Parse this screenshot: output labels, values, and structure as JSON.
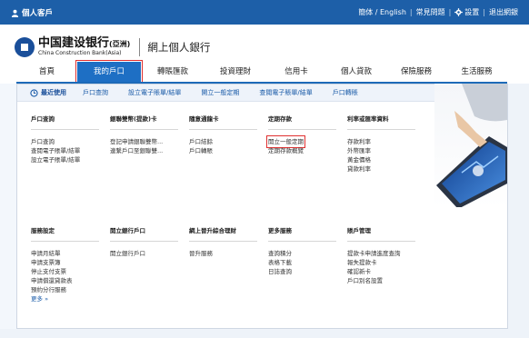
{
  "topbar": {
    "user_label": "個人客戶",
    "links": [
      "簡体 / English",
      "常見問題",
      "設置",
      "退出網銀"
    ]
  },
  "brand": {
    "name_cn": "中国建设银行",
    "name_suffix": "(亞洲)",
    "name_en": "China Construction Bank(Asia)",
    "portal": "網上個人銀行"
  },
  "nav": {
    "items": [
      "首頁",
      "我的戶口",
      "轉賬匯款",
      "投資理財",
      "信用卡",
      "個人貸款",
      "保險服務",
      "生活服務"
    ]
  },
  "subnav": {
    "recent_label": "最近使用",
    "items": [
      "戶口查詢",
      "設立電子賬單/結單",
      "開立一般定期",
      "查閱電子賬單/結單",
      "戶口轉賬"
    ]
  },
  "sections": {
    "account_query": {
      "title": "戶口查詢",
      "items": [
        "戶口查詢",
        "查閱電子賬單/結單",
        "設立電子賬單/結單"
      ]
    },
    "card_services": {
      "title": "銀聯雙幣(提款)卡",
      "items": [
        "登記申請銀聯雙幣...",
        "連繫戶口至銀聯雙..."
      ]
    },
    "travel_card": {
      "title": "隨意通龍卡",
      "items": [
        "戶口結餘",
        "戶口轉賬"
      ]
    },
    "time_deposit": {
      "title": "定期存款",
      "items": [
        "開立一般定期",
        "定期存款概覽"
      ]
    },
    "rates": {
      "title": "利率或匯率資料",
      "items": [
        "存款利率",
        "外幣匯率",
        "黃金價格",
        "貸款利率"
      ]
    },
    "service_settings": {
      "title": "服務設定",
      "items": [
        "申請月結單",
        "申請支票簿",
        "停止支付支票",
        "申請償還貸款表",
        "預約分行服務",
        "更多 »"
      ]
    },
    "open_account": {
      "title": "開立銀行戶口",
      "items": [
        "開立銀行戶口"
      ]
    },
    "online_upgrade": {
      "title": "網上晉升綜合理財",
      "items": [
        "晉升服務"
      ]
    },
    "more_services": {
      "title": "更多服務",
      "items": [
        "查詢積分",
        "表格下載",
        "日誌查詢"
      ]
    },
    "account_mgmt": {
      "title": "賬戶管理",
      "items": [
        "提款卡申請進度查詢",
        "報失提款卡",
        "確認新卡",
        "戶口別名設置"
      ]
    }
  }
}
